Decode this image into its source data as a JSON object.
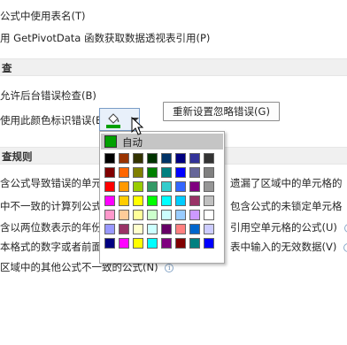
{
  "top_options": {
    "use_table_names": "公式中使用表名(T)",
    "use_getpivotdata": "用 GetPivotData 函数获取数据透视表引用(P)"
  },
  "error_checking": {
    "header": "查",
    "enable_background": "允许后台错误检查(B)",
    "color_label": "使用此颜色标识错误(E):",
    "reset_button": "重新设置忽略错误(G)"
  },
  "rules": {
    "header": "查规则",
    "left": [
      "含公式导致错误的单元",
      "中不一致的计算列公式",
      "含以两位数表示的年份",
      "本格式的数字或者前面",
      "区域中的其他公式不一致的公式(N)"
    ],
    "right": [
      "遗漏了区域中的单元格的",
      "包含公式的未锁定单元格",
      "引用空单元格的公式(U)",
      "表中输入的无效数据(V)"
    ]
  },
  "palette": {
    "auto_label": "自动",
    "auto_color": "#00a000",
    "colors": [
      "#000000",
      "#993300",
      "#333300",
      "#003300",
      "#003366",
      "#000080",
      "#333399",
      "#333333",
      "#800000",
      "#ff6600",
      "#808000",
      "#008000",
      "#008080",
      "#0000ff",
      "#666699",
      "#808080",
      "#ff0000",
      "#ff9900",
      "#99cc00",
      "#339966",
      "#33cccc",
      "#3366ff",
      "#800080",
      "#969696",
      "#ff00ff",
      "#ffcc00",
      "#ffff00",
      "#00ff00",
      "#00ffff",
      "#00ccff",
      "#993366",
      "#c0c0c0",
      "#ff99cc",
      "#ffcc99",
      "#ffff99",
      "#ccffcc",
      "#ccffff",
      "#99ccff",
      "#cc99ff",
      "#ffffff",
      "#9999ff",
      "#993366",
      "#ffffcc",
      "#ccffff",
      "#660066",
      "#ff8080",
      "#0066cc",
      "#ccccff",
      "#000080",
      "#ff00ff",
      "#ffff00",
      "#00ffff",
      "#800080",
      "#800000",
      "#008080",
      "#0000ff"
    ]
  }
}
